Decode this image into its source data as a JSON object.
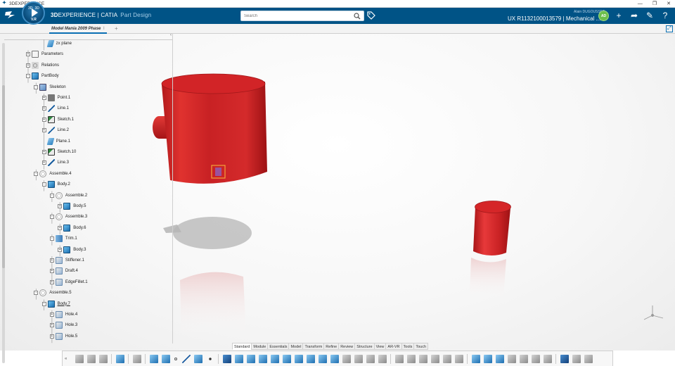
{
  "os": {
    "title": "3DEXPERIENCE",
    "controls": [
      "—",
      "❐",
      "✕"
    ]
  },
  "header": {
    "logo": "3DS",
    "compass_version": "V.R",
    "compass_n1": "3D",
    "compass_n2": "3D",
    "brand_bold": "3D",
    "brand_main": "EXPERIENCE | CATIA",
    "brand_app": "Part Design",
    "search_placeholder": "Search",
    "user_name": "Alain DUGOUSSET",
    "ux_label": "UX R1132100013579 | Mechanical ...",
    "avatar_initials": "AD",
    "accent": "#005386"
  },
  "tabs": [
    {
      "label": "Model Mania 2009 Phase",
      "close": "I"
    }
  ],
  "tab_add": "+",
  "tree": {
    "nodes": [
      {
        "label": "zx plane",
        "icon": "plane-icon",
        "kind": "plane",
        "expander": ""
      },
      {
        "label": "Parameters",
        "icon": "parameters-icon",
        "kind": "param",
        "expander": "+"
      },
      {
        "label": "Relations",
        "icon": "relations-icon",
        "kind": "rel",
        "expander": "+"
      },
      {
        "label": "PartBody",
        "icon": "partbody-icon",
        "kind": "body",
        "expander": "-"
      },
      {
        "label": "Skeleton",
        "icon": "skeleton-icon",
        "kind": "skel",
        "expander": "-"
      },
      {
        "label": "Point.1",
        "icon": "point-icon",
        "kind": "point",
        "expander": "+"
      },
      {
        "label": "Line.1",
        "icon": "line-icon",
        "kind": "line",
        "expander": "+"
      },
      {
        "label": "Sketch.1",
        "icon": "sketch-icon",
        "kind": "sketch",
        "expander": "+"
      },
      {
        "label": "Line.2",
        "icon": "line-icon",
        "kind": "line",
        "expander": "+"
      },
      {
        "label": "Plane.1",
        "icon": "plane-icon",
        "kind": "plane",
        "expander": ""
      },
      {
        "label": "Sketch.10",
        "icon": "sketch-icon",
        "kind": "sketch",
        "expander": "+"
      },
      {
        "label": "Line.3",
        "icon": "line-icon",
        "kind": "line",
        "expander": "+"
      },
      {
        "label": "Assemble.4",
        "icon": "assemble-icon",
        "kind": "assemble",
        "expander": "-"
      },
      {
        "label": "Body.2",
        "icon": "body-icon",
        "kind": "body",
        "expander": "-"
      },
      {
        "label": "Assemble.2",
        "icon": "assemble-icon",
        "kind": "assemble",
        "expander": "-"
      },
      {
        "label": "Body.5",
        "icon": "body-icon",
        "kind": "body",
        "expander": "+"
      },
      {
        "label": "Assemble.3",
        "icon": "assemble-icon",
        "kind": "assemble",
        "expander": "-"
      },
      {
        "label": "Body.6",
        "icon": "body-icon",
        "kind": "body",
        "expander": "+"
      },
      {
        "label": "Trim.1",
        "icon": "trim-icon",
        "kind": "trim",
        "expander": "-"
      },
      {
        "label": "Body.3",
        "icon": "body-icon",
        "kind": "body",
        "expander": "+"
      },
      {
        "label": "Stiffener.1",
        "icon": "stiffener-icon",
        "kind": "feat",
        "expander": "+"
      },
      {
        "label": "Draft.4",
        "icon": "draft-icon",
        "kind": "feat",
        "expander": "+"
      },
      {
        "label": "EdgeFillet.1",
        "icon": "edgefillet-icon",
        "kind": "feat",
        "expander": "+"
      },
      {
        "label": "Assemble.5",
        "icon": "assemble-icon",
        "kind": "assemble",
        "expander": "-"
      },
      {
        "label": "Body.7",
        "icon": "body-icon",
        "kind": "body",
        "expander": "-",
        "underline": true
      },
      {
        "label": "Hole.4",
        "icon": "hole-icon",
        "kind": "feat",
        "expander": "+"
      },
      {
        "label": "Hole.3",
        "icon": "hole-icon",
        "kind": "feat",
        "expander": "+"
      },
      {
        "label": "Hole.5",
        "icon": "hole-icon",
        "kind": "feat",
        "expander": "+"
      }
    ]
  },
  "command_tabs": [
    "Standard",
    "Module",
    "Essentials",
    "Model",
    "Transform",
    "Refine",
    "Review",
    "Structure",
    "View",
    "AR-VR",
    "Tools",
    "Touch"
  ],
  "active_command_tab": "Standard",
  "action_bar_chevron": "«",
  "colors": {
    "part_red": "#d9282b",
    "part_red_dark": "#a81416",
    "part_red_light": "#ef5a55"
  }
}
